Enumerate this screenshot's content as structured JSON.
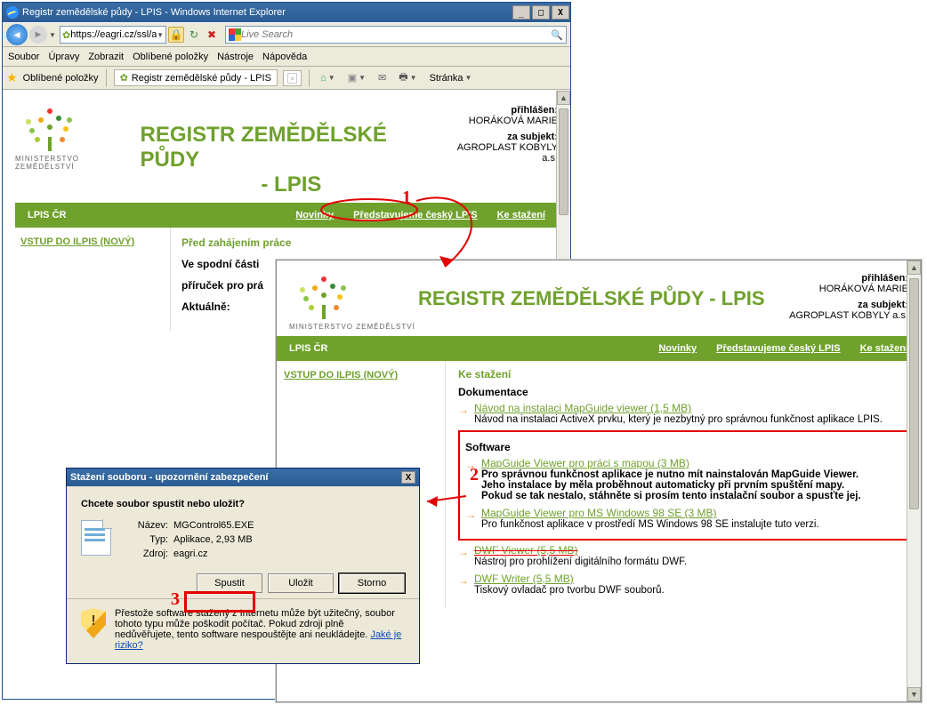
{
  "ie": {
    "title": "Registr zemědělské půdy - LPIS - Windows Internet Explorer",
    "url": "https://eagri.cz/ssl/a",
    "search_placeholder": "Live Search",
    "winbtns": {
      "min": "_",
      "max": "□",
      "close": "X"
    },
    "menu": {
      "soubor": "Soubor",
      "upravy": "Úpravy",
      "zobrazit": "Zobrazit",
      "oblibene": "Oblíbené položky",
      "nastroje": "Nástroje",
      "napoveda": "Nápověda"
    },
    "fav_label": "Oblíbené položky",
    "tab_label": "Registr zemědělské půdy - LPIS",
    "page_menu": "Stránka"
  },
  "lpis1": {
    "logo_label": "MINISTERSTVO ZEMĚDĚLSTVÍ",
    "title_line1": "REGISTR ZEMĚDĚLSKÉ PŮDY",
    "title_line2": "- LPIS",
    "user_label": "přihlášen:",
    "user_name": "HORÁKOVÁ MARIE",
    "subj_label": "za subjekt:",
    "subj_name": "AGROPLAST KOBYLY a.s.",
    "nav_home": "LPIS ČR",
    "nav": {
      "novinky": "Novinky",
      "predstav": "Představujeme český LPIS",
      "kestazeni": "Ke stažení"
    },
    "side_link": "VSTUP DO ILPIS (NOVÝ)",
    "main_h": "Před zahájením práce",
    "main_p1": "Ve spodní části",
    "main_p2": "příruček pro prá",
    "main_p3": "Aktuálně:"
  },
  "lpis2": {
    "title": "REGISTR ZEMĚDĚLSKÉ PŮDY - LPIS",
    "main_h": "Ke stažení",
    "doc_h": "Dokumentace",
    "doc1": "Návod na instalaci MapGuide viewer (1,5 MB)",
    "doc1_desc_cut": "Návod na instalaci ActiveX prvku, který je nezbytný pro správnou funkčnost aplikace LPIS.",
    "sw_h": "Software",
    "sw1": "MapGuide Viewer pro práci s mapou (3 MB)",
    "sw1_desc1": "Pro správnou funkčnost aplikace je nutno mít nainstalován MapGuide Viewer.",
    "sw1_desc2": "Jeho instalace by měla proběhnout automaticky při prvním spuštění mapy.",
    "sw1_desc3": "Pokud se tak nestalo, stáhněte si prosím tento instalační soubor a spusťte jej.",
    "sw2": "MapGuide Viewer pro MS Windows 98 SE (3 MB)",
    "sw2_desc": "Pro funkčnost aplikace v prostředí MS Windows 98 SE instalujte tuto verzi.",
    "sw3": "DWF Viewer (5,5 MB)",
    "sw3_desc": "Nástroj pro prohlížení digitálního formátu DWF.",
    "sw4": "DWF Writer (5,5 MB)",
    "sw4_desc": "Tiskový ovladač pro tvorbu DWF souborů."
  },
  "dlg": {
    "title": "Stažení souboru - upozornění zabezpečení",
    "question": "Chcete soubor spustit nebo uložit?",
    "name_lab": "Název:",
    "name_val": "MGControl65.EXE",
    "type_lab": "Typ:",
    "type_val": "Aplikace, 2,93 MB",
    "src_lab": "Zdroj:",
    "src_val": "eagri.cz",
    "btn_run": "Spustit",
    "btn_save": "Uložit",
    "btn_cancel": "Storno",
    "warn": "Přestože software stažený z Internetu může být užitečný, soubor tohoto typu může poškodit počítač. Pokud zdroji plně nedůvěřujete, tento software nespouštějte ani neukládejte.",
    "risk_link": "Jaké je riziko?"
  },
  "anno": {
    "n1": "1",
    "n2": "2",
    "n3": "3"
  }
}
